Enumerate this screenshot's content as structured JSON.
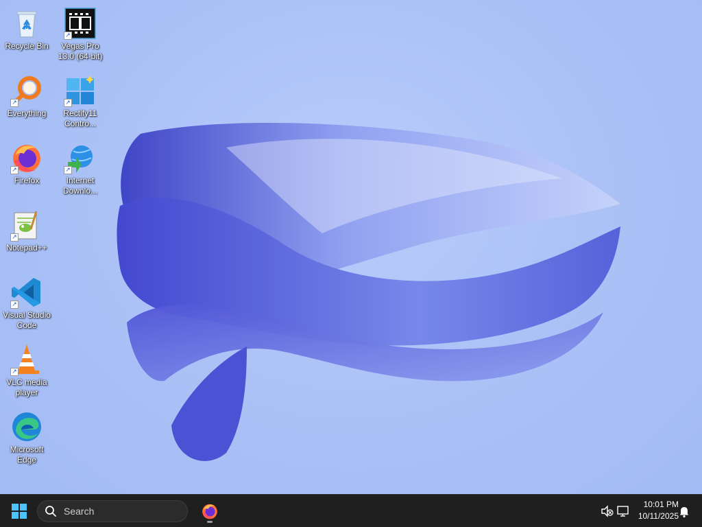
{
  "desktop": {
    "icons": [
      {
        "label": "Recycle Bin",
        "icon": "recycle-bin-icon"
      },
      {
        "label": "Vegas Pro 13.0 (64-bit)",
        "icon": "film-strip-icon"
      },
      {
        "label": "Everything",
        "icon": "magnifier-icon"
      },
      {
        "label": "Rectify11 Contro...",
        "icon": "windows-logo-icon"
      },
      {
        "label": "Firefox",
        "icon": "firefox-icon"
      },
      {
        "label": "Internet Downlo...",
        "icon": "globe-download-icon"
      },
      {
        "label": "Notepad++",
        "icon": "notepad-icon"
      },
      {
        "label": "Visual Studio Code",
        "icon": "vscode-icon"
      },
      {
        "label": "VLC media player",
        "icon": "traffic-cone-icon"
      },
      {
        "label": "Microsoft Edge",
        "icon": "edge-icon"
      }
    ],
    "shortcut_arrow": "↗"
  },
  "taskbar": {
    "search": {
      "placeholder": "Search"
    },
    "pinned": [
      {
        "app": "Firefox",
        "icon": "firefox-icon"
      }
    ],
    "tray": {
      "icons": [
        "speaker-muted-icon",
        "network-icon",
        "notification-bell-icon"
      ],
      "time": "10:01 PM",
      "date": "10/11/2025"
    }
  },
  "colors": {
    "wallpaper": "#a8bff5",
    "taskbar": "#1f1f1f",
    "accent": "#4a5ad8"
  }
}
